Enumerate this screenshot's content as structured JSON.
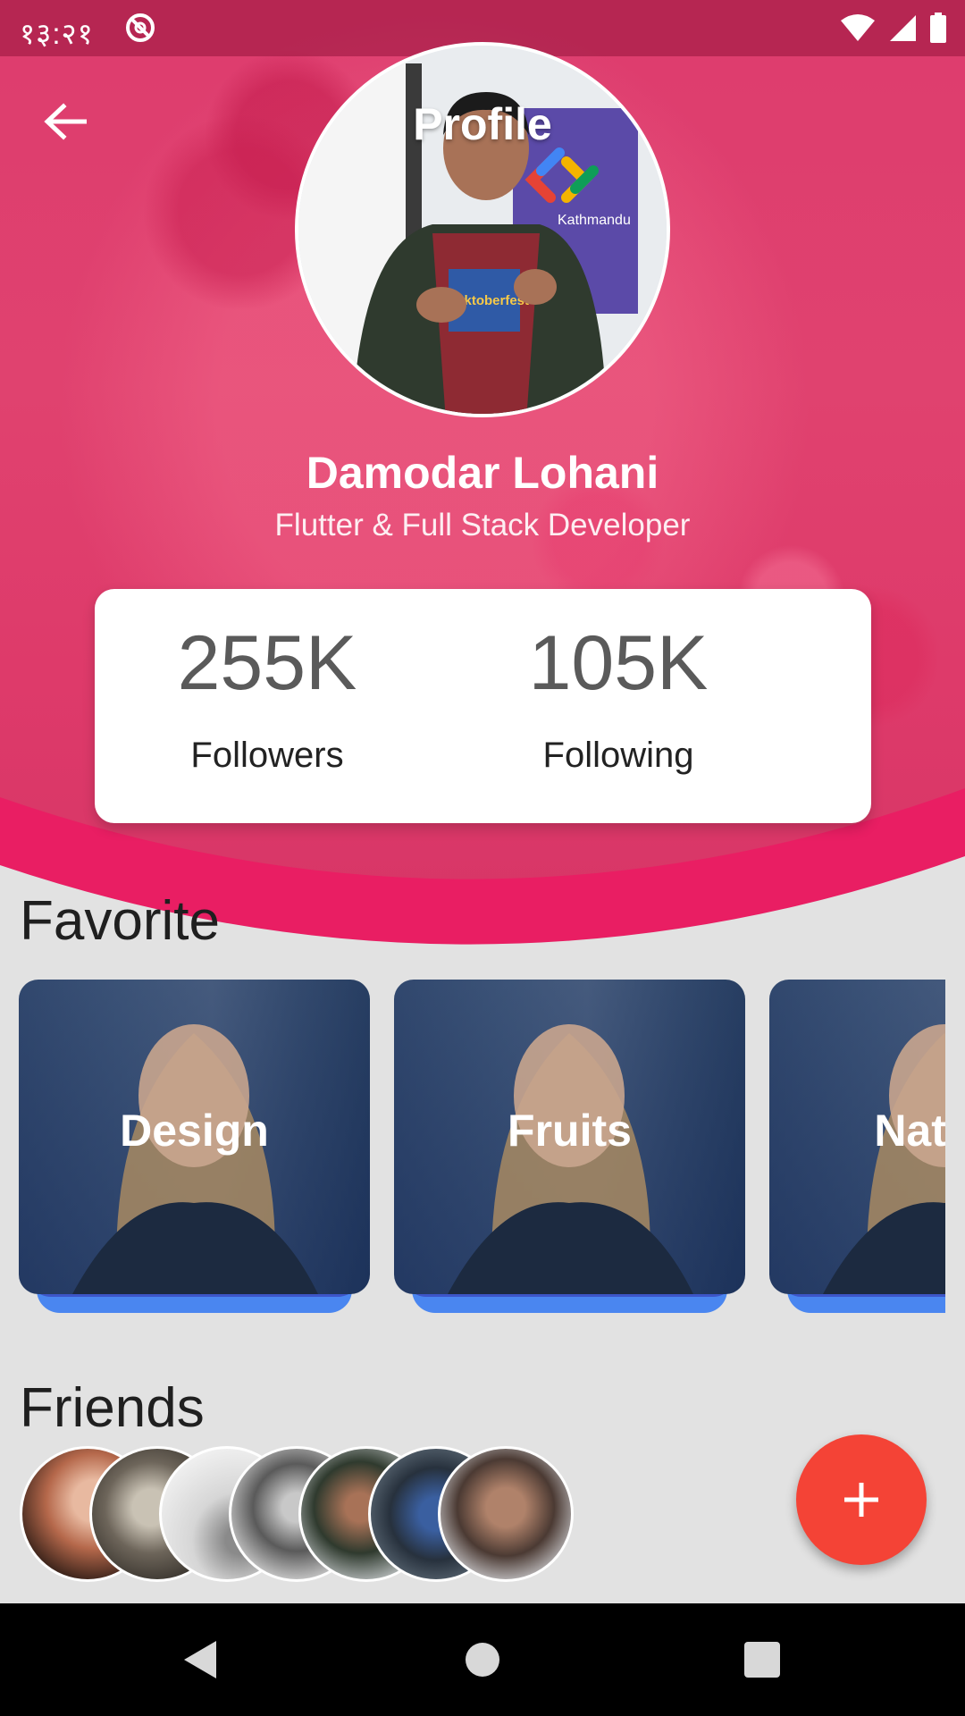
{
  "status_bar": {
    "time": "१३:२१",
    "dnd_icon": "do-not-disturb-icon",
    "wifi_icon": "wifi-icon",
    "signal_icon": "cell-signal-icon",
    "battery_icon": "battery-icon"
  },
  "header": {
    "title": "Profile",
    "back_icon": "arrow-back-icon",
    "accent_color": "#e91e63"
  },
  "profile": {
    "name": "Damodar Lohani",
    "role": "Flutter & Full Stack Developer",
    "badge_text": "Kathmandu",
    "shirt_text": "Hacktoberfest"
  },
  "stats": {
    "followers_value": "255K",
    "followers_label": "Followers",
    "following_value": "105K",
    "following_label": "Following"
  },
  "favorite": {
    "title": "Favorite",
    "items": [
      {
        "label": "Design"
      },
      {
        "label": "Fruits"
      },
      {
        "label": "Nature"
      }
    ]
  },
  "friends": {
    "title": "Friends",
    "count_visible": 7
  },
  "fab": {
    "icon": "plus-icon",
    "color": "#f44336"
  },
  "nav_bar": {
    "back_icon": "nav-back-icon",
    "home_icon": "nav-home-icon",
    "recents_icon": "nav-recents-icon"
  }
}
